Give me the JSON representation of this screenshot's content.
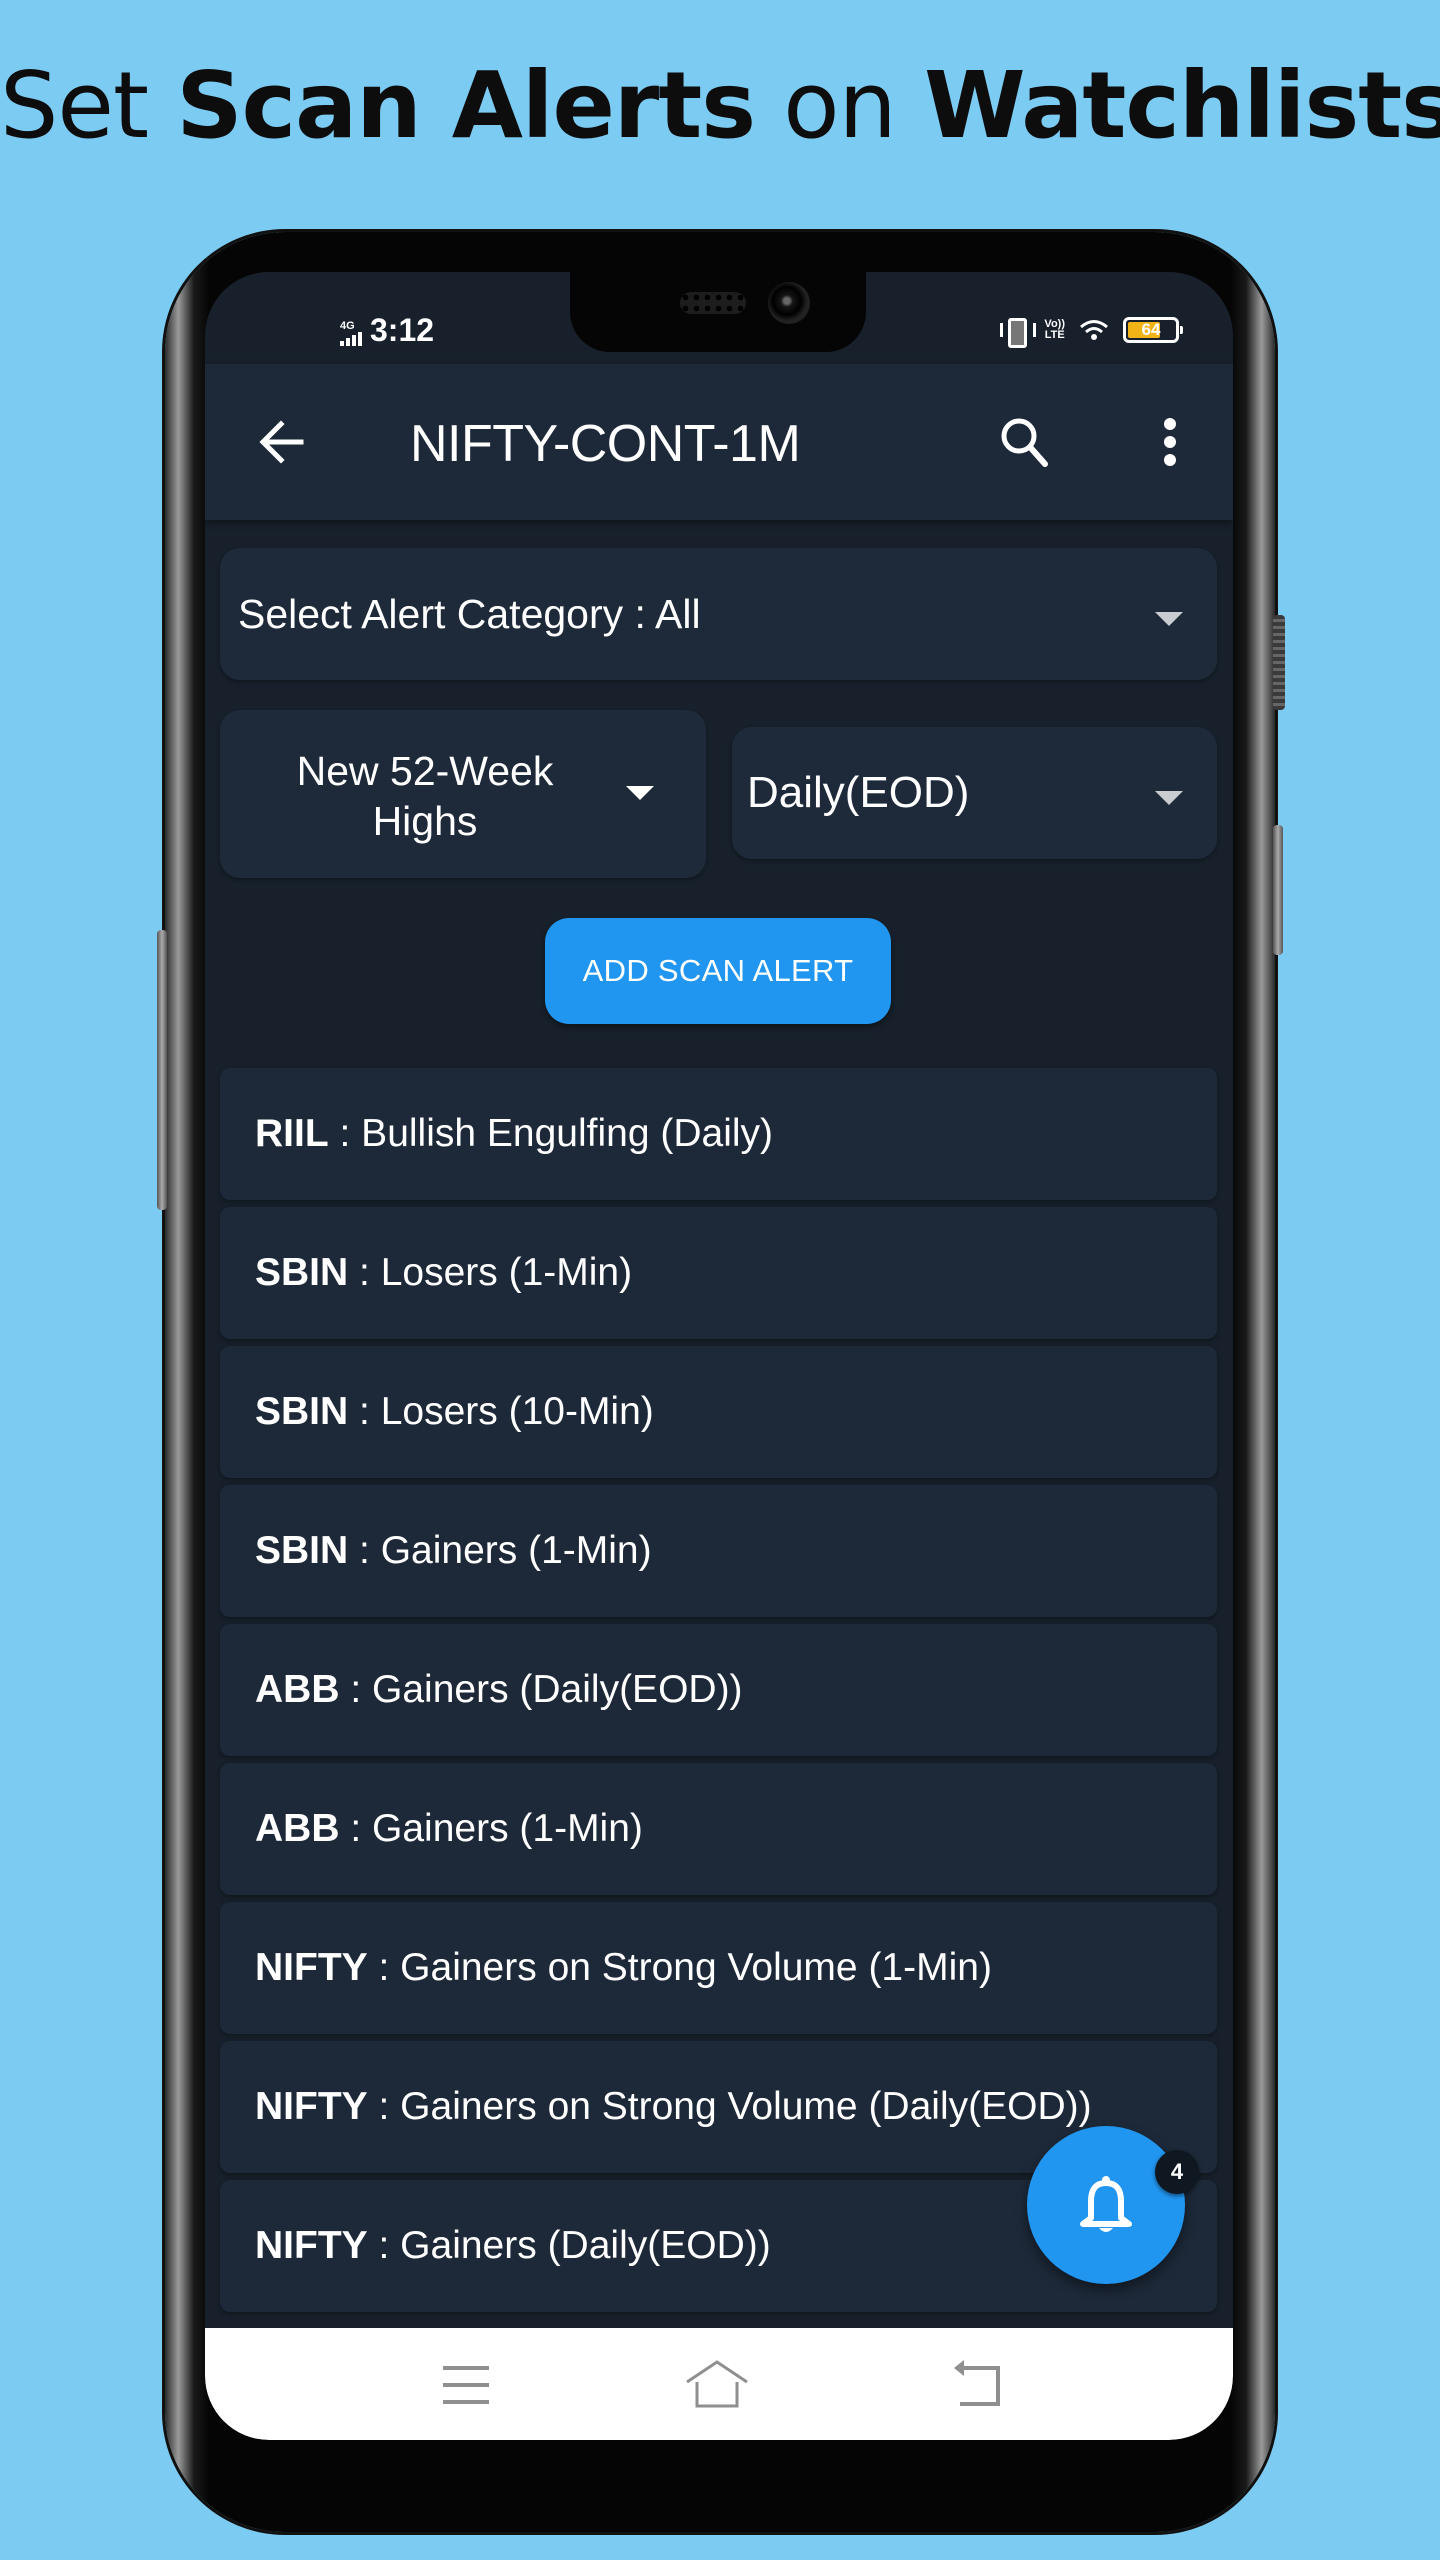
{
  "headline": {
    "parts": [
      {
        "text": "Set ",
        "style": "light"
      },
      {
        "text": "Scan Alerts",
        "style": "bold"
      },
      {
        "text": " on ",
        "style": "light"
      },
      {
        "text": "Watchlists",
        "style": "bold"
      }
    ]
  },
  "status_bar": {
    "network": "4G",
    "time": "3:12",
    "volte_top": "Vo))",
    "volte_bottom": "LTE",
    "battery_percent": "64",
    "icons": [
      "signal-icon",
      "vibrate-icon",
      "volte-icon",
      "wifi-icon",
      "battery-icon"
    ]
  },
  "app_bar": {
    "title": "NIFTY-CONT-1M",
    "icons": [
      "back-arrow-icon",
      "search-icon",
      "more-vert-icon"
    ]
  },
  "filters": {
    "category": {
      "label": "Select Alert Category : All"
    },
    "scan": {
      "selected": "New 52-Week Highs"
    },
    "interval": {
      "selected": "Daily(EOD)"
    }
  },
  "add_button": {
    "label": "ADD SCAN ALERT"
  },
  "alerts": [
    {
      "symbol": "RIIL",
      "description": " : Bullish Engulfing (Daily)"
    },
    {
      "symbol": "SBIN",
      "description": " : Losers (1-Min)"
    },
    {
      "symbol": "SBIN",
      "description": " : Losers (10-Min)"
    },
    {
      "symbol": "SBIN",
      "description": " : Gainers (1-Min)"
    },
    {
      "symbol": "ABB",
      "description": " : Gainers (Daily(EOD))"
    },
    {
      "symbol": "ABB",
      "description": " : Gainers (1-Min)"
    },
    {
      "symbol": "NIFTY",
      "description": " : Gainers on Strong Volume (1-Min)"
    },
    {
      "symbol": "NIFTY",
      "description": " : Gainers on Strong Volume (Daily(EOD))"
    },
    {
      "symbol": "NIFTY",
      "description": " : Gainers (Daily(EOD))"
    }
  ],
  "fab": {
    "icon": "bell-icon",
    "badge_count": "4"
  },
  "nav_bar": {
    "icons": [
      "recents-icon",
      "home-icon",
      "back-icon"
    ]
  },
  "colors": {
    "page_background": "#7ccbf2",
    "screen_background": "#17202b",
    "card_background": "#1d2939",
    "accent": "#2196f0",
    "battery_fill": "#f2b316"
  }
}
